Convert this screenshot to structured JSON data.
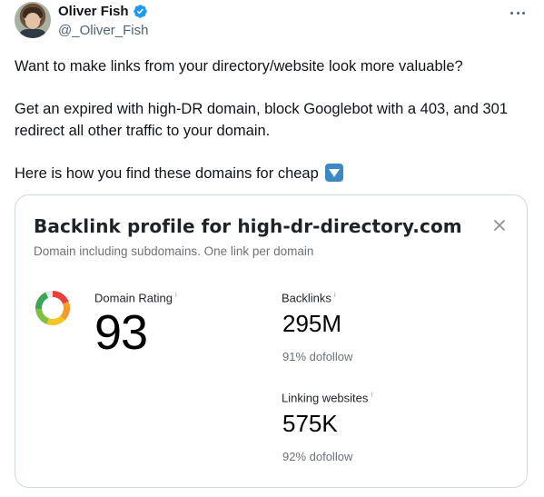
{
  "author": {
    "display_name": "Oliver Fish",
    "handle": "@_Oliver_Fish",
    "avatar_icon": "profile-photo",
    "verified_color": "#1d9bf0"
  },
  "tweet": {
    "lines": [
      "Want to make links from your directory/website look more valuable?",
      "Get an expired with high-DR domain, block Googlebot with a 403, and 301 redirect all other traffic to your domain.",
      "Here is how you find these domains for cheap"
    ],
    "emoji_icon": "down-arrow-button"
  },
  "card": {
    "title": "Backlink profile for high-dr-directory.com",
    "subtitle": "Domain including subdomains. One link per domain",
    "domain_rating": {
      "label": "Domain Rating",
      "info": "i",
      "value": "93",
      "gauge_fraction": 0.93,
      "gauge_colors": [
        "#e8413b",
        "#f39b2b",
        "#f5c521",
        "#7cc142",
        "#3aa655"
      ]
    },
    "backlinks": {
      "label": "Backlinks",
      "info": "i",
      "value": "295M",
      "sub": "91% dofollow"
    },
    "linking_websites": {
      "label": "Linking websites",
      "info": "i",
      "value": "575K",
      "sub": "92% dofollow"
    }
  }
}
